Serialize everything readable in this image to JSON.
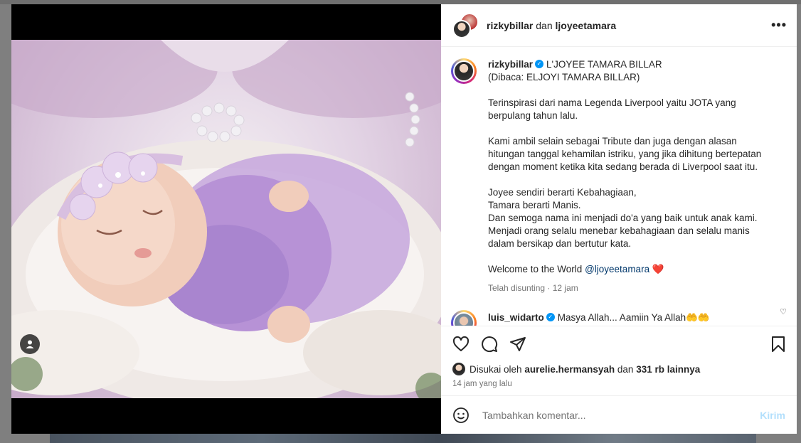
{
  "header": {
    "user1": "rizkybillar",
    "and_text": "dan",
    "user2": "ljoyeetamara",
    "more_icon": "more-horizontal-icon"
  },
  "caption": {
    "username": "rizkybillar",
    "verified": true,
    "title_line": "L'JOYEE TAMARA BILLAR",
    "paragraphs": [
      "(Dibaca: ELJOYI TAMARA BILLAR)",
      "Terinspirasi dari nama Legenda Liverpool yaitu JOTA yang\nberpulang tahun lalu.",
      "Kami ambil selain sebagai Tribute dan juga dengan alasan\nhitungan tanggal kehamilan istriku, yang jika dihitung bertepatan\ndengan moment ketika kita sedang berada di Liverpool saat itu.",
      "Joyee sendiri berarti Kebahagiaan,\nTamara berarti Manis.\nDan semoga nama ini menjadi do'a yang baik untuk anak kami.\nMenjadi orang selalu menebar kebahagiaan dan selalu manis\ndalam bersikap dan bertutur kata."
    ],
    "welcome_text": "Welcome to the World",
    "welcome_mention": "@ljoyeetamara",
    "welcome_emoji": "❤️",
    "time": "Telah disunting · 12 jam"
  },
  "comment": {
    "username": "luis_widarto",
    "verified": true,
    "text": "Masya Allah... Aamiin Ya Allah🤲🤲"
  },
  "actions": {
    "like_icon": "heart-icon",
    "comment_icon": "comment-icon",
    "share_icon": "share-icon",
    "save_icon": "bookmark-icon"
  },
  "likes": {
    "prefix": "Disukai oleh",
    "liker": "aurelie.hermansyah",
    "middle": "dan",
    "others": "331 rb lainnya"
  },
  "post_time": "14 jam yang lalu",
  "add_comment": {
    "placeholder": "Tambahkan komentar...",
    "post_label": "Kirim",
    "emoji_icon": "emoji-icon"
  },
  "media": {
    "user_tag_icon": "user-tag-icon"
  }
}
